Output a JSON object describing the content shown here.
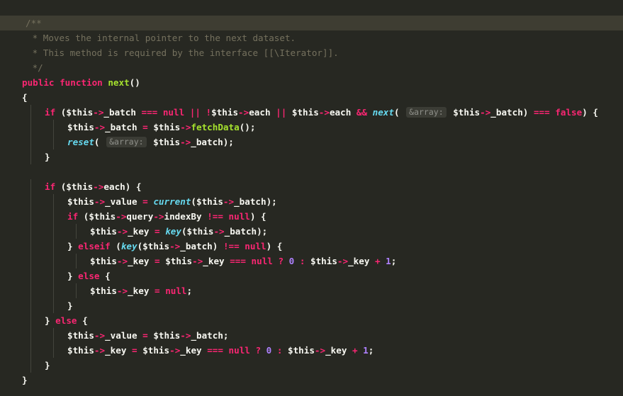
{
  "editor": {
    "language": "php",
    "theme_colors": {
      "background": "#272822",
      "current_line": "#3e3d32",
      "comment": "#75715e",
      "keyword": "#f92672",
      "function": "#a6e22e",
      "builtin": "#66d9ef",
      "constant": "#ae81ff",
      "text": "#f8f8f2"
    },
    "lines": [
      [
        {
          "t": "c",
          "v": "/**"
        }
      ],
      [
        {
          "t": "c",
          "v": " * Moves the internal pointer to the next dataset."
        }
      ],
      [
        {
          "t": "c",
          "v": " * This method is required by the interface [[\\Iterator]]."
        }
      ],
      [
        {
          "t": "c",
          "v": " */"
        }
      ],
      [
        {
          "t": "k",
          "v": "public function "
        },
        {
          "t": "f",
          "v": "next"
        },
        {
          "t": "p",
          "v": "()"
        }
      ],
      [
        {
          "t": "p",
          "v": "{"
        }
      ],
      [
        {
          "t": "k",
          "v": "if "
        },
        {
          "t": "p",
          "v": "($this"
        },
        {
          "t": "o",
          "v": "->"
        },
        {
          "t": "p",
          "v": "_batch "
        },
        {
          "t": "o",
          "v": "=== "
        },
        {
          "t": "k",
          "v": "null "
        },
        {
          "t": "o",
          "v": "|| !"
        },
        {
          "t": "p",
          "v": "$this"
        },
        {
          "t": "o",
          "v": "->"
        },
        {
          "t": "p",
          "v": "each "
        },
        {
          "t": "o",
          "v": "|| "
        },
        {
          "t": "p",
          "v": "$this"
        },
        {
          "t": "o",
          "v": "->"
        },
        {
          "t": "p",
          "v": "each "
        },
        {
          "t": "o",
          "v": "&& "
        },
        {
          "t": "b",
          "v": "next"
        },
        {
          "t": "p",
          "v": "( "
        },
        {
          "t": "h",
          "v": "&array:"
        },
        {
          "t": "p",
          "v": " $this"
        },
        {
          "t": "o",
          "v": "->"
        },
        {
          "t": "p",
          "v": "_batch) "
        },
        {
          "t": "o",
          "v": "=== "
        },
        {
          "t": "k",
          "v": "false"
        },
        {
          "t": "p",
          "v": ") {"
        }
      ],
      [
        {
          "t": "p",
          "v": "$this"
        },
        {
          "t": "o",
          "v": "->"
        },
        {
          "t": "p",
          "v": "_batch "
        },
        {
          "t": "o",
          "v": "= "
        },
        {
          "t": "p",
          "v": "$this"
        },
        {
          "t": "o",
          "v": "->"
        },
        {
          "t": "f",
          "v": "fetchData"
        },
        {
          "t": "p",
          "v": "();"
        }
      ],
      [
        {
          "t": "b",
          "v": "reset"
        },
        {
          "t": "p",
          "v": "( "
        },
        {
          "t": "h",
          "v": "&array:"
        },
        {
          "t": "p",
          "v": " $this"
        },
        {
          "t": "o",
          "v": "->"
        },
        {
          "t": "p",
          "v": "_batch);"
        }
      ],
      [
        {
          "t": "p",
          "v": "}"
        }
      ],
      [],
      [
        {
          "t": "k",
          "v": "if "
        },
        {
          "t": "p",
          "v": "($this"
        },
        {
          "t": "o",
          "v": "->"
        },
        {
          "t": "p",
          "v": "each) {"
        }
      ],
      [
        {
          "t": "p",
          "v": "$this"
        },
        {
          "t": "o",
          "v": "->"
        },
        {
          "t": "p",
          "v": "_value "
        },
        {
          "t": "o",
          "v": "= "
        },
        {
          "t": "b",
          "v": "current"
        },
        {
          "t": "p",
          "v": "($this"
        },
        {
          "t": "o",
          "v": "->"
        },
        {
          "t": "p",
          "v": "_batch);"
        }
      ],
      [
        {
          "t": "k",
          "v": "if "
        },
        {
          "t": "p",
          "v": "($this"
        },
        {
          "t": "o",
          "v": "->"
        },
        {
          "t": "p",
          "v": "query"
        },
        {
          "t": "o",
          "v": "->"
        },
        {
          "t": "p",
          "v": "indexBy "
        },
        {
          "t": "o",
          "v": "!== "
        },
        {
          "t": "k",
          "v": "null"
        },
        {
          "t": "p",
          "v": ") {"
        }
      ],
      [
        {
          "t": "p",
          "v": "$this"
        },
        {
          "t": "o",
          "v": "->"
        },
        {
          "t": "p",
          "v": "_key "
        },
        {
          "t": "o",
          "v": "= "
        },
        {
          "t": "b",
          "v": "key"
        },
        {
          "t": "p",
          "v": "($this"
        },
        {
          "t": "o",
          "v": "->"
        },
        {
          "t": "p",
          "v": "_batch);"
        }
      ],
      [
        {
          "t": "p",
          "v": "} "
        },
        {
          "t": "k",
          "v": "elseif "
        },
        {
          "t": "p",
          "v": "("
        },
        {
          "t": "b",
          "v": "key"
        },
        {
          "t": "p",
          "v": "($this"
        },
        {
          "t": "o",
          "v": "->"
        },
        {
          "t": "p",
          "v": "_batch) "
        },
        {
          "t": "o",
          "v": "!== "
        },
        {
          "t": "k",
          "v": "null"
        },
        {
          "t": "p",
          "v": ") {"
        }
      ],
      [
        {
          "t": "p",
          "v": "$this"
        },
        {
          "t": "o",
          "v": "->"
        },
        {
          "t": "p",
          "v": "_key "
        },
        {
          "t": "o",
          "v": "= "
        },
        {
          "t": "p",
          "v": "$this"
        },
        {
          "t": "o",
          "v": "->"
        },
        {
          "t": "p",
          "v": "_key "
        },
        {
          "t": "o",
          "v": "=== "
        },
        {
          "t": "k",
          "v": "null "
        },
        {
          "t": "o",
          "v": "? "
        },
        {
          "t": "n",
          "v": "0"
        },
        {
          "t": "o",
          "v": " : "
        },
        {
          "t": "p",
          "v": "$this"
        },
        {
          "t": "o",
          "v": "->"
        },
        {
          "t": "p",
          "v": "_key "
        },
        {
          "t": "o",
          "v": "+ "
        },
        {
          "t": "n",
          "v": "1"
        },
        {
          "t": "p",
          "v": ";"
        }
      ],
      [
        {
          "t": "p",
          "v": "} "
        },
        {
          "t": "k",
          "v": "else "
        },
        {
          "t": "p",
          "v": "{"
        }
      ],
      [
        {
          "t": "p",
          "v": "$this"
        },
        {
          "t": "o",
          "v": "->"
        },
        {
          "t": "p",
          "v": "_key "
        },
        {
          "t": "o",
          "v": "= "
        },
        {
          "t": "k",
          "v": "null"
        },
        {
          "t": "p",
          "v": ";"
        }
      ],
      [
        {
          "t": "p",
          "v": "}"
        }
      ],
      [
        {
          "t": "p",
          "v": "} "
        },
        {
          "t": "k",
          "v": "else "
        },
        {
          "t": "p",
          "v": "{"
        }
      ],
      [
        {
          "t": "p",
          "v": "$this"
        },
        {
          "t": "o",
          "v": "->"
        },
        {
          "t": "p",
          "v": "_value "
        },
        {
          "t": "o",
          "v": "= "
        },
        {
          "t": "p",
          "v": "$this"
        },
        {
          "t": "o",
          "v": "->"
        },
        {
          "t": "p",
          "v": "_batch;"
        }
      ],
      [
        {
          "t": "p",
          "v": "$this"
        },
        {
          "t": "o",
          "v": "->"
        },
        {
          "t": "p",
          "v": "_key "
        },
        {
          "t": "o",
          "v": "= "
        },
        {
          "t": "p",
          "v": "$this"
        },
        {
          "t": "o",
          "v": "->"
        },
        {
          "t": "p",
          "v": "_key "
        },
        {
          "t": "o",
          "v": "=== "
        },
        {
          "t": "k",
          "v": "null "
        },
        {
          "t": "o",
          "v": "? "
        },
        {
          "t": "n",
          "v": "0"
        },
        {
          "t": "o",
          "v": " : "
        },
        {
          "t": "p",
          "v": "$this"
        },
        {
          "t": "o",
          "v": "->"
        },
        {
          "t": "p",
          "v": "_key "
        },
        {
          "t": "o",
          "v": "+ "
        },
        {
          "t": "n",
          "v": "1"
        },
        {
          "t": "p",
          "v": ";"
        }
      ],
      [
        {
          "t": "p",
          "v": "}"
        }
      ],
      [
        {
          "t": "p",
          "v": "}"
        }
      ]
    ]
  }
}
